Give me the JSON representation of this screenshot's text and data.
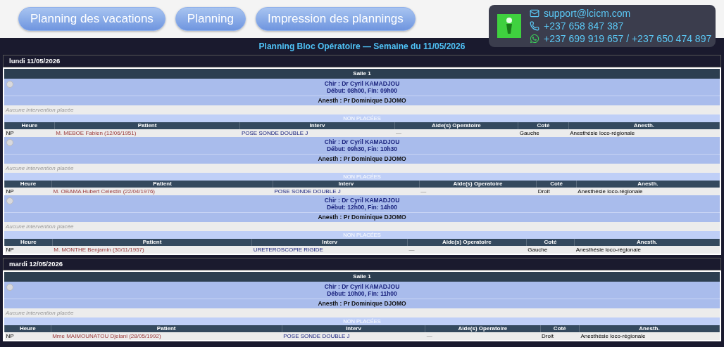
{
  "nav": {
    "buttons": [
      "Planning des vacations",
      "Planning",
      "Impression des plannings"
    ]
  },
  "contact": {
    "email": "support@lcicm.com",
    "phone": "+237 658 847 387",
    "whatsapp": "+237 699 919 657 / +237 650 474 897"
  },
  "title": "Planning Bloc Opératoire — Semaine du 11/05/2026",
  "days": [
    {
      "label": "lundi 11/05/2026",
      "rooms": [
        {
          "name": "Salle 1",
          "vacations": [
            {
              "chir": "Chir : Dr Cyril KAMADJOU",
              "times": "Début: 08h00, Fin: 09h00",
              "anesth": "Anesth : Pr Dominique DJOMO",
              "note": "Aucune intervention placée",
              "unplaced": "NON PLACÉES",
              "columns": [
                "Heure",
                "Patient",
                "Interv",
                "Aide(s) Operatoire",
                "Coté",
                "Anesth."
              ],
              "rows": [
                {
                  "cells": [
                    "NP",
                    "M. MEBOE Fabien (12/06/1951)",
                    "POSE SONDE DOUBLE J",
                    "—",
                    "Gauche",
                    "Anesthésie loco-régionale"
                  ]
                }
              ]
            },
            {
              "chir": "Chir : Dr Cyril KAMADJOU",
              "times": "Début: 09h30, Fin: 10h30",
              "anesth": "Anesth : Pr Dominique DJOMO",
              "note": "Aucune intervention placée",
              "unplaced": "NON PLACÉES",
              "columns": [
                "Heure",
                "Patient",
                "Interv",
                "Aide(s) Operatoire",
                "Coté",
                "Anesth."
              ],
              "rows": [
                {
                  "cells": [
                    "NP",
                    "M. OBAMA Hubert Celestin (22/04/1976)",
                    "POSE SONDE DOUBLE J",
                    "—",
                    "Droit",
                    "Anesthésie loco-régionale"
                  ]
                }
              ]
            },
            {
              "chir": "Chir : Dr Cyril KAMADJOU",
              "times": "Début: 12h00, Fin: 14h00",
              "anesth": "Anesth : Pr Dominique DJOMO",
              "note": "Aucune intervention placée",
              "unplaced": "NON PLACÉES",
              "columns": [
                "Heure",
                "Patient",
                "Interv",
                "Aide(s) Operatoire",
                "Coté",
                "Anesth."
              ],
              "rows": [
                {
                  "cells": [
                    "NP",
                    "M. MONTHE Benjamin (30/11/1957)",
                    "URETEROSCOPIE RIGIDE",
                    "—",
                    "Gauche",
                    "Anesthésie loco-régionale"
                  ]
                }
              ]
            }
          ]
        }
      ]
    },
    {
      "label": "mardi 12/05/2026",
      "rooms": [
        {
          "name": "Salle 1",
          "vacations": [
            {
              "chir": "Chir : Dr Cyril KAMADJOU",
              "times": "Début: 10h00, Fin: 11h00",
              "anesth": "Anesth : Pr Dominique DJOMO",
              "note": "Aucune intervention placée",
              "unplaced": "NON PLACÉES",
              "columns": [
                "Heure",
                "Patient",
                "Interv",
                "Aide(s) Operatoire",
                "Coté",
                "Anesth."
              ],
              "rows": [
                {
                  "cells": [
                    "NP",
                    "Mme MAIMOUNATOU Djelani (28/05/1992)",
                    "POSE SONDE DOUBLE J",
                    "—",
                    "Droit",
                    "Anesthésie loco-régionale"
                  ]
                }
              ]
            }
          ]
        }
      ]
    }
  ]
}
